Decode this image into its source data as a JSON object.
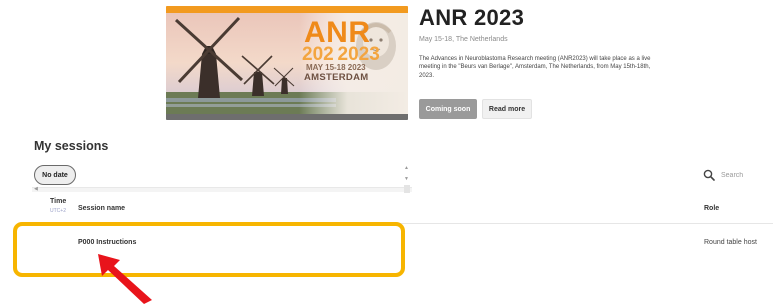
{
  "banner": {
    "anr": "ANR",
    "year": "202 2023",
    "dates": "MAY 15-18 2023",
    "city": "AMSTERDAM"
  },
  "event": {
    "title": "ANR 2023",
    "subtitle": "May 15-18, The Netherlands",
    "description": "The Advances in Neuroblastoma Research meeting (ANR2023) will take place as a live meeting in the \"Beurs van Berlage\", Amsterdam, The Netherlands, from May 15th-18th, 2023.",
    "coming_soon_label": "Coming soon",
    "read_more_label": "Read more"
  },
  "sessions": {
    "heading": "My sessions",
    "date_filter": "No date",
    "search_placeholder": "Search",
    "columns": {
      "time": "Time",
      "timezone": "UTC+2",
      "name": "Session name",
      "role": "Role"
    },
    "rows": [
      {
        "name": "P000 Instructions",
        "role": "Round table host"
      }
    ]
  },
  "icons": {
    "search": "search-icon",
    "scroll_left": "chevron-left-icon",
    "scroll_right": "chevron-right-icon",
    "scroll_up": "chevron-up-icon",
    "scroll_down": "chevron-down-icon",
    "annotation_arrow": "arrow-icon"
  },
  "colors": {
    "banner_orange": "#f29a1f",
    "highlight": "#f7b500",
    "arrow": "#e8141b",
    "button_grey": "#9a9a9a"
  }
}
